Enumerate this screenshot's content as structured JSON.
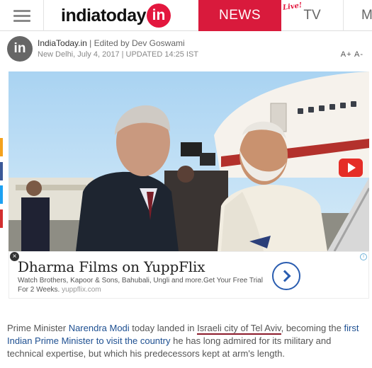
{
  "nav": {
    "logo_text": "indiatoday",
    "logo_badge": "in",
    "tabs": [
      {
        "label": "NEWS",
        "active": true
      },
      {
        "label": "TV",
        "active": false
      },
      {
        "label": "M",
        "active": false
      }
    ],
    "live_badge": "Live!"
  },
  "byline": {
    "avatar_text": "in",
    "source": "IndiaToday.in",
    "separator": " | Edited by ",
    "editor": "Dev Goswami",
    "dateline": "New Delhi, July 4, 2017 | UPDATED 14:25 IST",
    "font_controls": "A+ A-"
  },
  "media": {
    "play_icon": "youtube-play-icon"
  },
  "ad": {
    "title": "Dharma Films on YuppFlix",
    "description": "Watch Brothers, Kapoor & Sons, Bahubali, Ungli and more.Get Your Free Trial For 2 Weeks.",
    "domain": "yuppflix.com",
    "close_label": "×",
    "info_label": "i"
  },
  "article": {
    "p1": "Prime Minister ",
    "link1": "Narendra Modi",
    "p2": " today landed in ",
    "highlight": "Israeli city of Tel Aviv",
    "p3": ", becoming the ",
    "link2": "first Indian Prime Minister to visit the country",
    "p4": " he has long admired for its military and technical expertise, but which his predecessors kept at arm's length."
  },
  "colors": {
    "brand_red": "#d91a3c",
    "link_blue": "#1d4f91",
    "social": [
      "#f4a21d",
      "#3b5998",
      "#1da1f2",
      "#d32f2f"
    ]
  }
}
